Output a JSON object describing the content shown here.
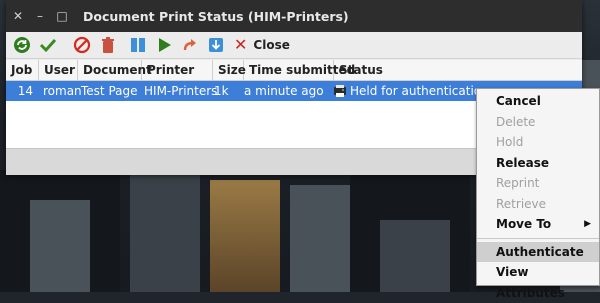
{
  "window": {
    "title": "Document Print Status (HIM-Printers)",
    "buttons": [
      "close-icon",
      "minimize-icon",
      "maximize-icon"
    ]
  },
  "toolbar": {
    "icons": [
      "refresh-icon",
      "check-icon",
      "cancel-circle-icon",
      "trash-icon",
      "pause-icon",
      "play-icon",
      "redo-arrow-icon",
      "download-icon"
    ],
    "close_label": "Close"
  },
  "table": {
    "columns": [
      "Job",
      "User",
      "Document",
      "Printer",
      "Size",
      "Time submitted",
      "Status"
    ],
    "rows": [
      {
        "job": "14",
        "user": "roman",
        "document": "Test Page",
        "printer": "HIM-Printers",
        "size": "1k",
        "time": "a minute ago",
        "status": "Held for authentication"
      }
    ]
  },
  "context_menu": {
    "items": [
      {
        "label": "Cancel",
        "enabled": true
      },
      {
        "label": "Delete",
        "enabled": false
      },
      {
        "label": "Hold",
        "enabled": false
      },
      {
        "label": "Release",
        "enabled": true
      },
      {
        "label": "Reprint",
        "enabled": false
      },
      {
        "label": "Retrieve",
        "enabled": false
      },
      {
        "label": "Move To",
        "enabled": true,
        "submenu": true
      },
      {
        "label": "Authenticate",
        "enabled": true,
        "highlighted": true
      },
      {
        "label": "View Attributes",
        "enabled": true
      }
    ]
  },
  "colors": {
    "selection": "#3d7ed8",
    "titlebar": "#2d2d2d",
    "close_red": "#c8261e"
  }
}
